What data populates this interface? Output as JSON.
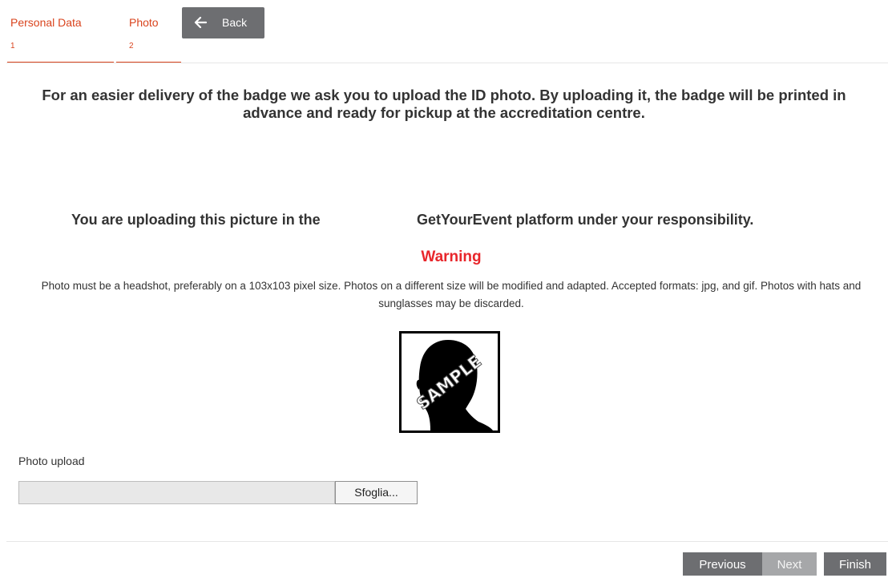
{
  "tabs": [
    {
      "label": "Personal Data",
      "number": "1"
    },
    {
      "label": "Photo",
      "number": "2"
    }
  ],
  "back_button": {
    "label": "Back",
    "icon": "arrow-left-icon"
  },
  "intro_text": "For an easier delivery of the badge we ask you to upload the ID photo. By uploading it, the badge will be printed in advance and ready for pickup at the accreditation centre.",
  "responsibility": {
    "part1": "You are uploading this picture in the",
    "part2": "GetYourEvent platform under your responsibility."
  },
  "warning": {
    "title": "Warning",
    "text": "Photo must be a headshot, preferably on a 103x103 pixel size. Photos on a different size will be modified and adapted. Accepted formats: jpg, and gif. Photos with hats and sunglasses may be discarded."
  },
  "sample_photo": {
    "watermark": "SAMPLE"
  },
  "upload": {
    "label": "Photo upload",
    "value": "",
    "browse_label": "Sfoglia..."
  },
  "footer": {
    "previous": "Previous",
    "next": "Next",
    "finish": "Finish"
  },
  "colors": {
    "accent": "#d9441e",
    "warning": "#e8262b",
    "button": "#6d6e71",
    "button_disabled": "#a6a7a9"
  }
}
